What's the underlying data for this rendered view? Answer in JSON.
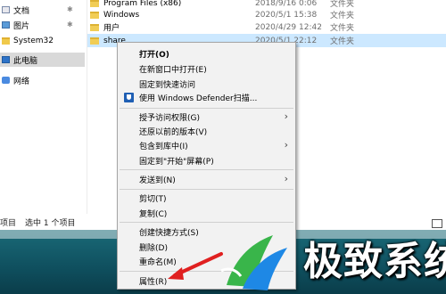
{
  "nav": {
    "items": [
      {
        "label": "文档",
        "pinned": true
      },
      {
        "label": "图片",
        "pinned": true
      },
      {
        "label": "System32",
        "pinned": false
      },
      {
        "label": "此电脑",
        "pinned": false
      },
      {
        "label": "网络",
        "pinned": false
      }
    ]
  },
  "files": [
    {
      "name": "Program Files (x86)",
      "date": "2018/9/16 0:06",
      "type": "文件夹"
    },
    {
      "name": "Windows",
      "date": "2020/5/1 15:38",
      "type": "文件夹"
    },
    {
      "name": "用户",
      "date": "2020/4/29 12:42",
      "type": "文件夹"
    },
    {
      "name": "share",
      "date": "2020/5/1 22:12",
      "type": "文件夹"
    }
  ],
  "status": {
    "count": "项目",
    "selected": "选中 1 个项目"
  },
  "menu": {
    "open": "打开(O)",
    "open_new_window": "在新窗口中打开(E)",
    "pin_quick_access": "固定到快速访问",
    "defender_scan": "使用 Windows Defender扫描...",
    "grant_access": "授予访问权限(G)",
    "restore_versions": "还原以前的版本(V)",
    "include_library": "包含到库中(I)",
    "pin_start": "固定到\"开始\"屏幕(P)",
    "send_to": "发送到(N)",
    "cut": "剪切(T)",
    "copy": "复制(C)",
    "create_shortcut": "创建快捷方式(S)",
    "delete": "删除(D)",
    "rename": "重命名(M)",
    "properties": "属性(R)"
  },
  "watermark": {
    "text": "极致系统"
  },
  "colors": {
    "selection": "#cce8ff",
    "accent_red": "#e02020",
    "desktop": "#0f4f5e"
  }
}
